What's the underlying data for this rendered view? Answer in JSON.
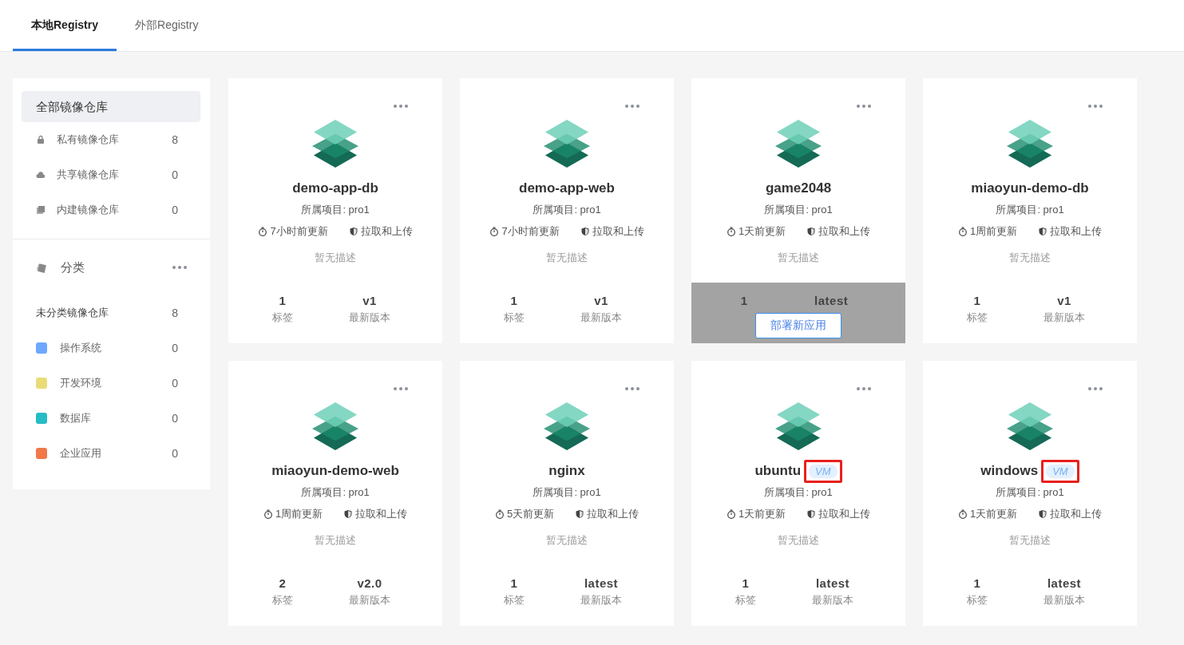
{
  "tabs": [
    {
      "label": "本地Registry",
      "selected": true
    },
    {
      "label": "外部Registry",
      "selected": false
    }
  ],
  "sidebar": {
    "all": {
      "label": "全部镜像仓库",
      "selected": true
    },
    "repos": [
      {
        "kind": "lock",
        "label": "私有镜像仓库",
        "count": "8"
      },
      {
        "kind": "cloud",
        "label": "共享镜像仓库",
        "count": "0"
      },
      {
        "kind": "stack",
        "label": "内建镜像仓库",
        "count": "0"
      }
    ],
    "category_title": "分类",
    "uncategorized": {
      "label": "未分类镜像仓库",
      "count": "8"
    },
    "categories": [
      {
        "label": "操作系统",
        "count": "0",
        "color": "#6ea8fe"
      },
      {
        "label": "开发环境",
        "count": "0",
        "color": "#e8dc78"
      },
      {
        "label": "数据库",
        "count": "0",
        "color": "#26bcc4"
      },
      {
        "label": "企业应用",
        "count": "0",
        "color": "#f0784a"
      }
    ]
  },
  "cards": [
    {
      "name": "demo-app-db",
      "project": "所属项目: pro1",
      "updated": "7小时前更新",
      "permission": "拉取和上传",
      "description": "暂无描述",
      "tags": "1",
      "tags_label": "标签",
      "version": "v1",
      "version_label": "最新版本"
    },
    {
      "name": "demo-app-web",
      "project": "所属项目: pro1",
      "updated": "7小时前更新",
      "permission": "拉取和上传",
      "description": "暂无描述",
      "tags": "1",
      "tags_label": "标签",
      "version": "v1",
      "version_label": "最新版本"
    },
    {
      "name": "game2048",
      "project": "所属项目: pro1",
      "updated": "1天前更新",
      "permission": "拉取和上传",
      "description": "暂无描述",
      "tags": "1",
      "version": "latest",
      "hover_button": "部署新应用"
    },
    {
      "name": "miaoyun-demo-db",
      "project": "所属项目: pro1",
      "updated": "1周前更新",
      "permission": "拉取和上传",
      "description": "暂无描述",
      "tags": "1",
      "tags_label": "标签",
      "version": "v1",
      "version_label": "最新版本"
    },
    {
      "name": "miaoyun-demo-web",
      "project": "所属项目: pro1",
      "updated": "1周前更新",
      "permission": "拉取和上传",
      "description": "暂无描述",
      "tags": "2",
      "tags_label": "标签",
      "version": "v2.0",
      "version_label": "最新版本"
    },
    {
      "name": "nginx",
      "project": "所属项目: pro1",
      "updated": "5天前更新",
      "permission": "拉取和上传",
      "description": "暂无描述",
      "tags": "1",
      "tags_label": "标签",
      "version": "latest",
      "version_label": "最新版本"
    },
    {
      "name": "ubuntu",
      "badge": {
        "label": "VM",
        "highlighted": true
      },
      "project": "所属项目: pro1",
      "updated": "1天前更新",
      "permission": "拉取和上传",
      "description": "暂无描述",
      "tags": "1",
      "tags_label": "标签",
      "version": "latest",
      "version_label": "最新版本"
    },
    {
      "name": "windows",
      "badge": {
        "label": "VM",
        "highlighted": true
      },
      "project": "所属项目: pro1",
      "updated": "1天前更新",
      "permission": "拉取和上传",
      "description": "暂无描述",
      "tags": "1",
      "tags_label": "标签",
      "version": "latest",
      "version_label": "最新版本"
    }
  ]
}
